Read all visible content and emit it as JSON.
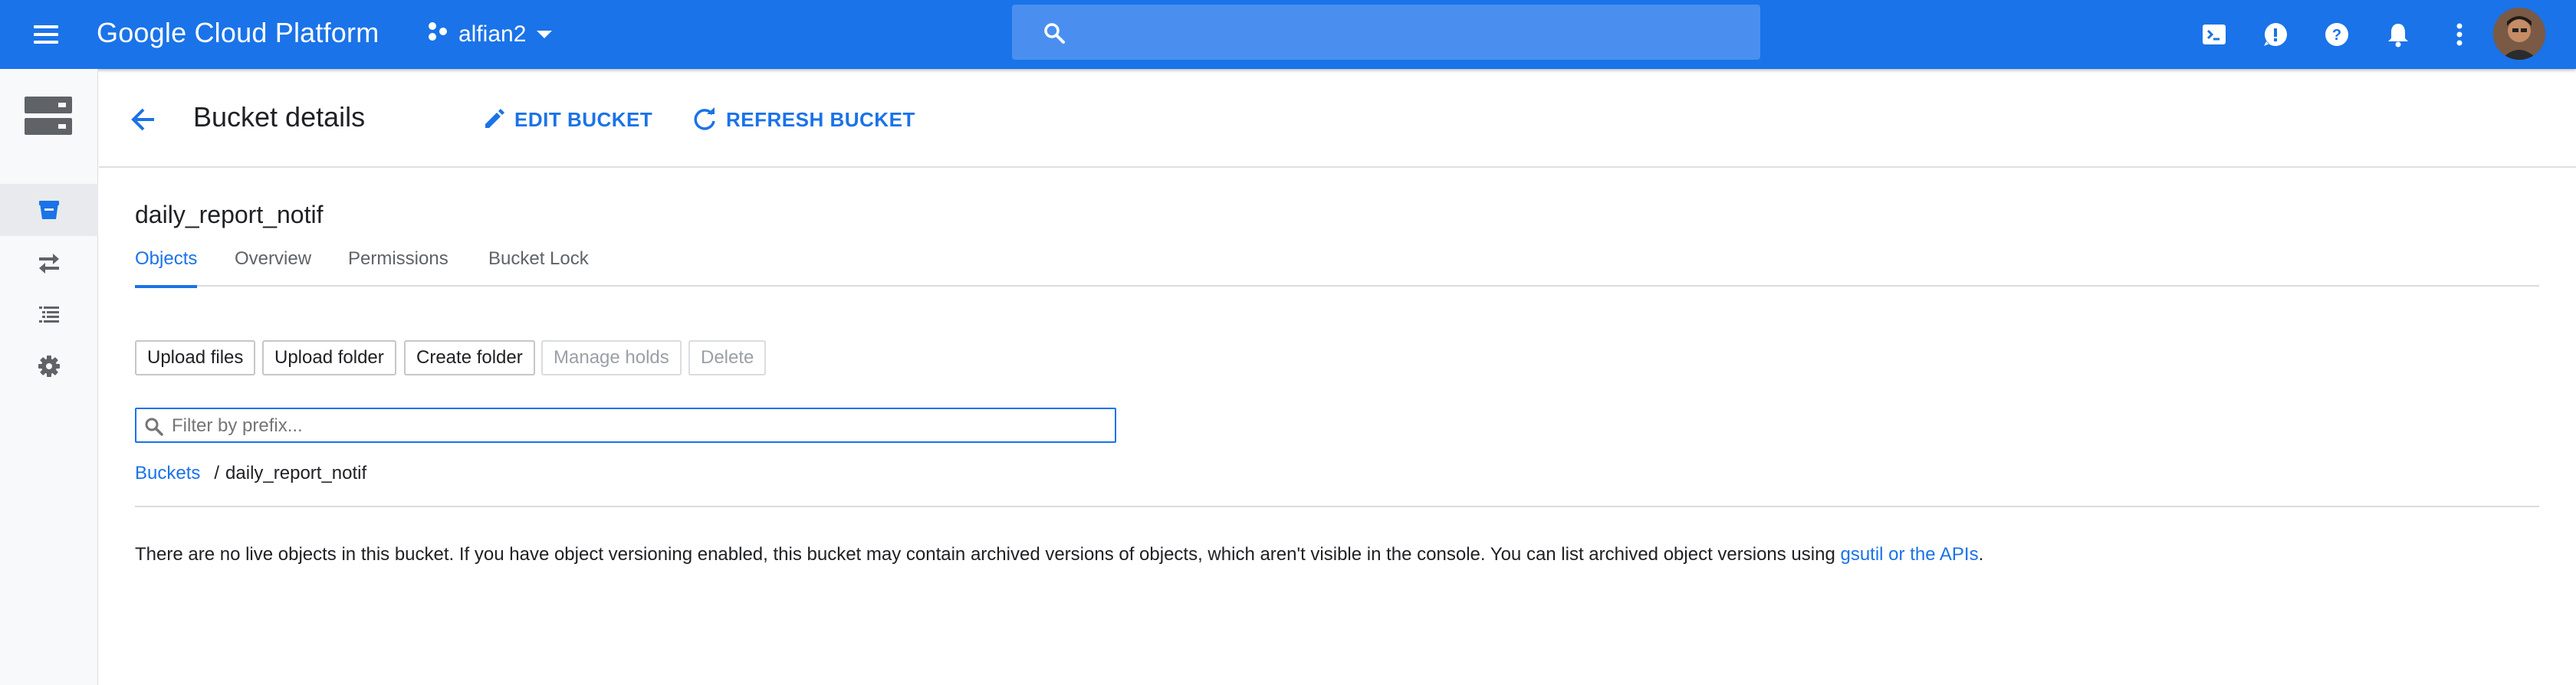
{
  "topbar": {
    "brand": "Google Cloud Platform",
    "project_name": "alfian2",
    "search_placeholder": "",
    "icons": [
      "menu-icon",
      "project-icon",
      "search-icon",
      "cloud-shell-icon",
      "feedback-icon",
      "help-icon",
      "notifications-icon",
      "more-vert-icon",
      "avatar"
    ]
  },
  "leftnav": {
    "items": [
      {
        "name": "storage-product-icon"
      },
      {
        "name": "browser-icon",
        "active": true
      },
      {
        "name": "transfer-icon"
      },
      {
        "name": "transfer-appliance-icon"
      },
      {
        "name": "settings-icon"
      }
    ]
  },
  "header": {
    "title": "Bucket details",
    "edit_label": "EDIT BUCKET",
    "refresh_label": "REFRESH BUCKET"
  },
  "bucket": {
    "name": "daily_report_notif"
  },
  "tabs": [
    {
      "label": "Objects",
      "active": true
    },
    {
      "label": "Overview"
    },
    {
      "label": "Permissions"
    },
    {
      "label": "Bucket Lock"
    }
  ],
  "actions": {
    "upload_files": "Upload files",
    "upload_folder": "Upload folder",
    "create_folder": "Create folder",
    "manage_holds": "Manage holds",
    "delete": "Delete"
  },
  "filter": {
    "placeholder": "Filter by prefix..."
  },
  "breadcrumb": {
    "root": "Buckets",
    "separator": "/",
    "current": "daily_report_notif"
  },
  "notice": {
    "text": "There are no live objects in this bucket. If you have object versioning enabled, this bucket may contain archived versions of objects, which aren't visible in the console. You can list archived object versions using ",
    "link": "gsutil or the APIs",
    "end": "."
  },
  "colors": {
    "topbar": "#1a73e8",
    "accent": "#1a73e8",
    "text": "#202124",
    "disabled": "#9aa0a6"
  }
}
